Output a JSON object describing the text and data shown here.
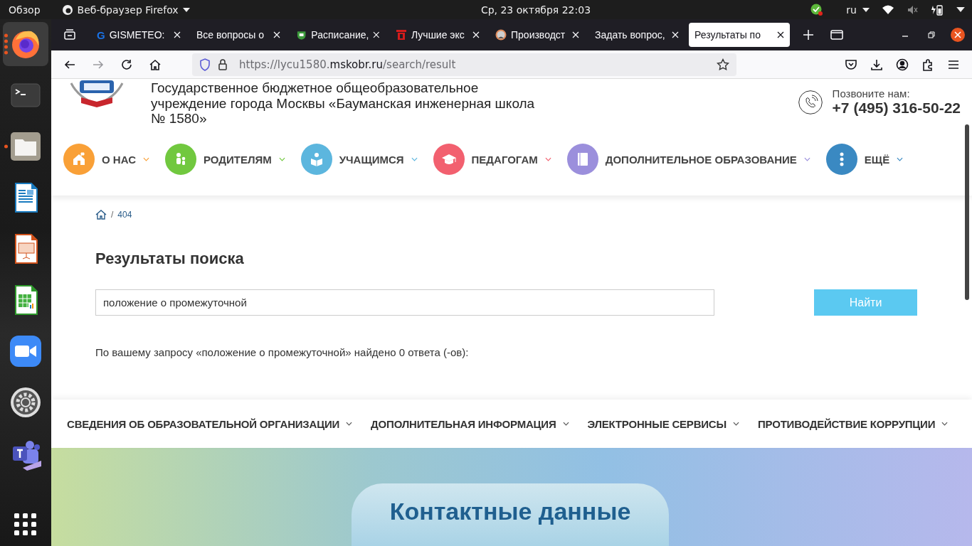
{
  "top_bar": {
    "activities": "Обзор",
    "app_menu": "Веб-браузер Firefox",
    "clock": "Ср, 23 октября  22:03",
    "keyboard_layout": "ru"
  },
  "dock": [
    {
      "kind": "browser",
      "selected": true,
      "running": true
    },
    {
      "kind": "terminal",
      "selected": false,
      "running": false
    },
    {
      "kind": "files",
      "selected": false,
      "running": true
    },
    {
      "kind": "writer",
      "selected": false,
      "running": false
    },
    {
      "kind": "impress",
      "selected": false,
      "running": false
    },
    {
      "kind": "calc",
      "selected": false,
      "running": false
    },
    {
      "kind": "video",
      "selected": false,
      "running": false
    },
    {
      "kind": "settings",
      "selected": false,
      "running": false
    },
    {
      "kind": "teams",
      "selected": false,
      "running": false
    }
  ],
  "tabs": [
    {
      "title": "GISMETEO:",
      "kind": "letter",
      "favicon_text": "G",
      "selected": false
    },
    {
      "title": "Все вопросы о",
      "kind": "plain",
      "selected": false
    },
    {
      "title": "Расписание,",
      "kind": "emblem",
      "selected": false
    },
    {
      "title": "Лучшие экс",
      "kind": "square",
      "selected": false
    },
    {
      "title": "Производст",
      "kind": "avatar",
      "selected": false
    },
    {
      "title": "Задать вопрос,",
      "kind": "plain",
      "selected": false
    },
    {
      "title": "Результаты по",
      "kind": "plain",
      "selected": true
    }
  ],
  "address_bar": {
    "url_parts": [
      "https://lycu1580.",
      "mskobr.ru",
      "/search/result"
    ]
  },
  "site_header": {
    "title_lines": [
      "Государственное бюджетное общеобразовательное",
      "учреждение города Москвы «Бауманская инженерная школа",
      "№ 1580»"
    ],
    "call_label": "Позвоните нам:",
    "phone": "+7 (495) 316-50-22"
  },
  "main_menu": [
    {
      "label": "О НАС",
      "color": "#f9a037"
    },
    {
      "label": "РОДИТЕЛЯМ",
      "color": "#71c83f"
    },
    {
      "label": "УЧАЩИМСЯ",
      "color": "#5cb6de"
    },
    {
      "label": "ПЕДАГОГАМ",
      "color": "#f2606f"
    },
    {
      "label": "ДОПОЛНИТЕЛЬНОЕ ОБРАЗОВАНИЕ",
      "color": "#9b8fdc"
    },
    {
      "label": "ЕЩЁ",
      "color": "#3a89c2"
    }
  ],
  "breadcrumb": {
    "separator": "/",
    "items": [
      "404"
    ]
  },
  "search": {
    "heading": "Результаты поиска",
    "value": "положение о промежуточной",
    "button": "Найти",
    "result": "По вашему запросу «положение о промежуточной» найдено 0 ответа (-ов):"
  },
  "footer_menu": [
    "СВЕДЕНИЯ ОБ ОБРАЗОВАТЕЛЬНОЙ ОРГАНИЗАЦИИ",
    "ДОПОЛНИТЕЛЬНАЯ ИНФОРМАЦИЯ",
    "ЭЛЕКТРОННЫЕ СЕРВИСЫ",
    "ПРОТИВОДЕЙСТВИЕ КОРРУПЦИИ"
  ],
  "contacts": {
    "title": "Контактные данные"
  }
}
